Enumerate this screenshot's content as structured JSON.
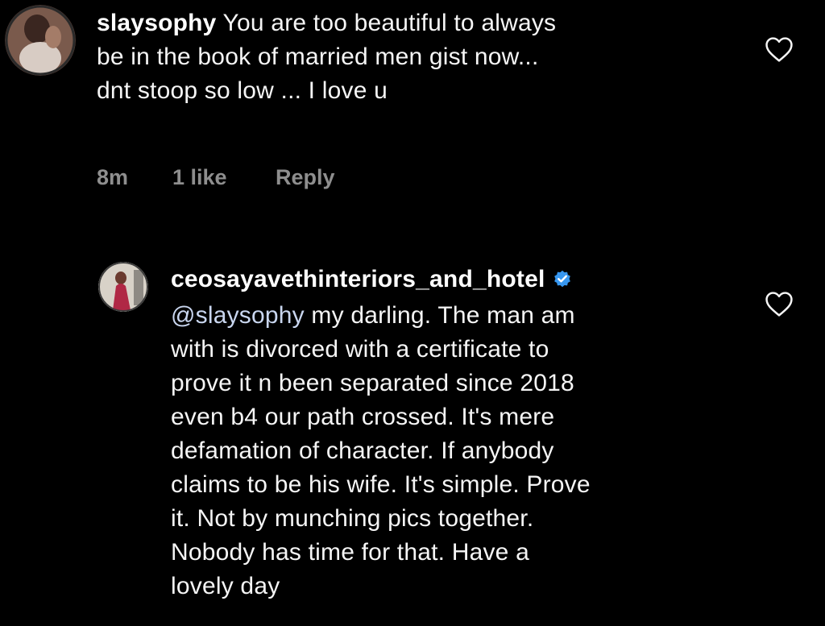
{
  "comments": [
    {
      "username": "slaysophy",
      "lines": [
        "You are too beautiful to always",
        "be in the book of married men gist now...",
        "dnt stoop so low ... I love u"
      ],
      "time": "8m",
      "likes": "1 like",
      "reply_label": "Reply",
      "like_icon": "heart-outline-icon"
    },
    {
      "username": "ceosayavethinteriors_and_hotel",
      "verified": true,
      "mention": "@slaysophy",
      "lines": [
        "my darling. The man am",
        "with is divorced with a certificate to",
        "prove it n been separated since 2018",
        "even b4 our path crossed.  It's mere",
        "defamation of character. If anybody",
        "claims to be his wife. It's simple. Prove",
        "it. Not by munching pics together.",
        "Nobody has time for that.  Have a",
        "lovely day"
      ],
      "like_icon": "heart-outline-icon"
    }
  ],
  "colors": {
    "background": "#000000",
    "text": "#f5f5f5",
    "meta": "#8e8e8e",
    "verified": "#3797f0"
  }
}
